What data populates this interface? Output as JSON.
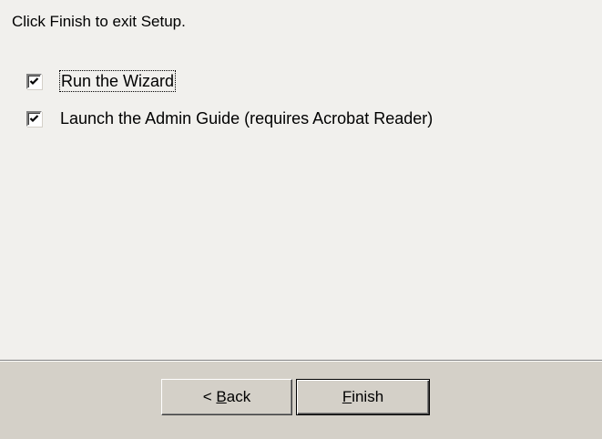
{
  "intro_text": "Click Finish to exit Setup.",
  "options": [
    {
      "label": "Run the Wizard",
      "checked": true
    },
    {
      "label": "Launch the Admin Guide (requires Acrobat Reader)",
      "checked": true
    }
  ],
  "buttons": {
    "back": {
      "prefix": "< ",
      "mnemonic": "B",
      "rest": "ack"
    },
    "finish": {
      "mnemonic": "F",
      "rest": "inish"
    }
  },
  "colors": {
    "content_bg": "#f1f0ed",
    "footer_bg": "#d4d0c8"
  }
}
